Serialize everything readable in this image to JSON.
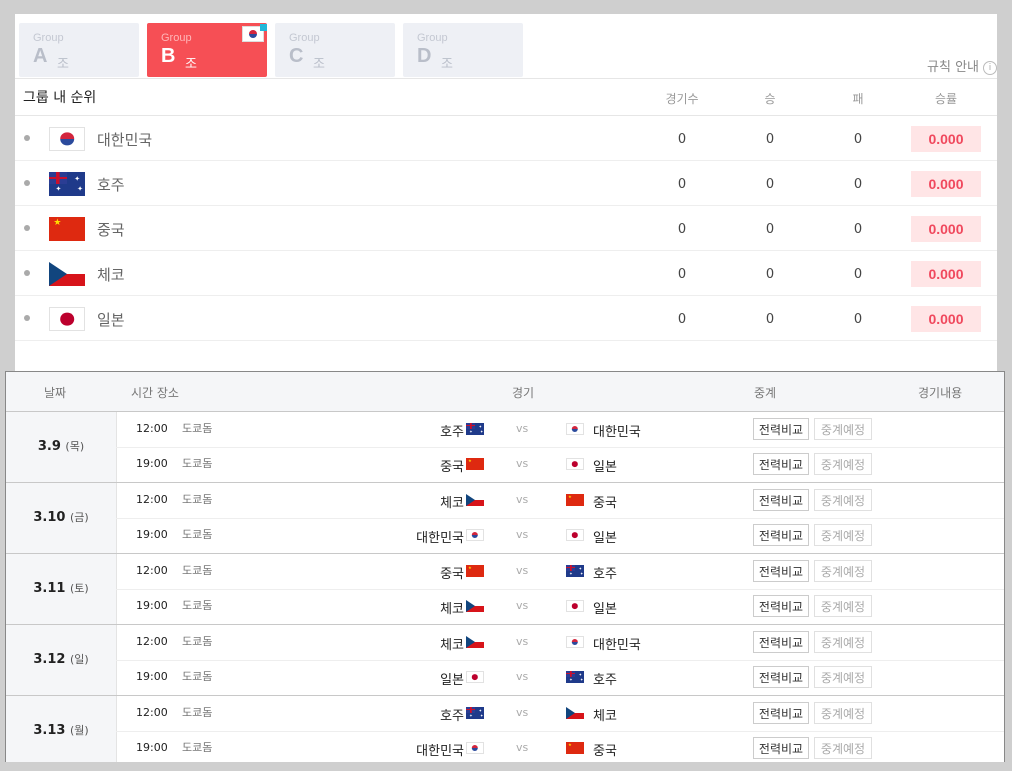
{
  "tabs": [
    {
      "group": "Group",
      "letter": "A",
      "jo": "조",
      "active": false
    },
    {
      "group": "Group",
      "letter": "B",
      "jo": "조",
      "active": true
    },
    {
      "group": "Group",
      "letter": "C",
      "jo": "조",
      "active": false
    },
    {
      "group": "Group",
      "letter": "D",
      "jo": "조",
      "active": false
    }
  ],
  "rule_link": "규칙 안내",
  "standings": {
    "title": "그룹 내 순위",
    "columns": [
      "경기수",
      "승",
      "패",
      "승률"
    ],
    "rows": [
      {
        "flag": "kor",
        "team": "대한민국",
        "games": "0",
        "win": "0",
        "loss": "0",
        "pct": "0.000"
      },
      {
        "flag": "aus",
        "team": "호주",
        "games": "0",
        "win": "0",
        "loss": "0",
        "pct": "0.000"
      },
      {
        "flag": "chn",
        "team": "중국",
        "games": "0",
        "win": "0",
        "loss": "0",
        "pct": "0.000"
      },
      {
        "flag": "cze",
        "team": "체코",
        "games": "0",
        "win": "0",
        "loss": "0",
        "pct": "0.000"
      },
      {
        "flag": "jpn",
        "team": "일본",
        "games": "0",
        "win": "0",
        "loss": "0",
        "pct": "0.000"
      }
    ]
  },
  "schedule": {
    "headers": {
      "date": "날짜",
      "time_place": "시간 장소",
      "game": "경기",
      "broadcast": "중계",
      "detail": "경기내용"
    },
    "vs": "vs",
    "btn_compare": "전력비교",
    "btn_broadcast": "중계예정",
    "days": [
      {
        "date": "3.9",
        "dow": "(목)",
        "games": [
          {
            "time": "12:00",
            "place": "도쿄돔",
            "home": "호주",
            "home_flag": "aus",
            "away": "대한민국",
            "away_flag": "kor"
          },
          {
            "time": "19:00",
            "place": "도쿄돔",
            "home": "중국",
            "home_flag": "chn",
            "away": "일본",
            "away_flag": "jpn"
          }
        ]
      },
      {
        "date": "3.10",
        "dow": "(금)",
        "games": [
          {
            "time": "12:00",
            "place": "도쿄돔",
            "home": "체코",
            "home_flag": "cze",
            "away": "중국",
            "away_flag": "chn"
          },
          {
            "time": "19:00",
            "place": "도쿄돔",
            "home": "대한민국",
            "home_flag": "kor",
            "away": "일본",
            "away_flag": "jpn"
          }
        ]
      },
      {
        "date": "3.11",
        "dow": "(토)",
        "games": [
          {
            "time": "12:00",
            "place": "도쿄돔",
            "home": "중국",
            "home_flag": "chn",
            "away": "호주",
            "away_flag": "aus"
          },
          {
            "time": "19:00",
            "place": "도쿄돔",
            "home": "체코",
            "home_flag": "cze",
            "away": "일본",
            "away_flag": "jpn"
          }
        ]
      },
      {
        "date": "3.12",
        "dow": "(일)",
        "games": [
          {
            "time": "12:00",
            "place": "도쿄돔",
            "home": "체코",
            "home_flag": "cze",
            "away": "대한민국",
            "away_flag": "kor"
          },
          {
            "time": "19:00",
            "place": "도쿄돔",
            "home": "일본",
            "home_flag": "jpn",
            "away": "호주",
            "away_flag": "aus"
          }
        ]
      },
      {
        "date": "3.13",
        "dow": "(월)",
        "games": [
          {
            "time": "12:00",
            "place": "도쿄돔",
            "home": "호주",
            "home_flag": "aus",
            "away": "체코",
            "away_flag": "cze"
          },
          {
            "time": "19:00",
            "place": "도쿄돔",
            "home": "대한민국",
            "home_flag": "kor",
            "away": "중국",
            "away_flag": "chn"
          }
        ]
      }
    ]
  }
}
